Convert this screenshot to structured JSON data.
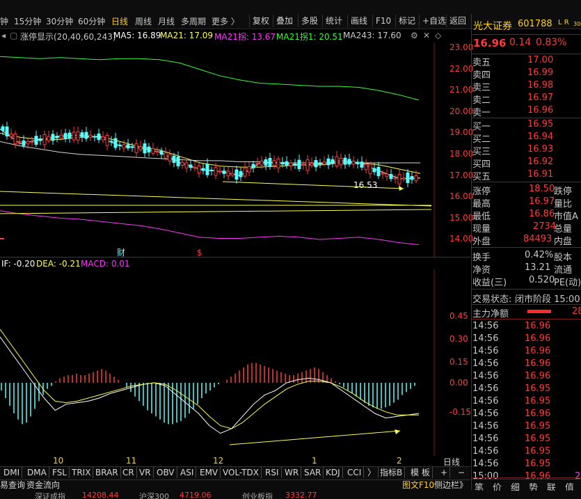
{
  "toolbar": {
    "periods": [
      "钟",
      "15分钟",
      "30分钟",
      "60分钟",
      "日线",
      "周线",
      "月线",
      "多周期",
      "更多 〉"
    ],
    "active_period": "日线",
    "tools": [
      "复权",
      "叠加",
      "多股",
      "统计",
      "画线",
      "F10",
      "标记",
      "+自选",
      "返回"
    ]
  },
  "indicator_line": {
    "label": "涨停显示(20,40,60,243)",
    "ma5": "MA5: 16.89",
    "ma21": "MA21: 17.09",
    "ma21ext": "MA21拐: 13.67",
    "ma21ext1": "MA21拐1: 20.51",
    "ma243": "MA243: 17.60"
  },
  "macd_line": {
    "dif": "IF: -0.20",
    "dea": "DEA: -0.21",
    "macd": "MACD: 0.01"
  },
  "colors": {
    "up": "#ff3a3a",
    "down": "#54ffff",
    "ma5": "#ffffff",
    "ma21": "#ffff4d",
    "ma21ext": "#ff33ff",
    "ma21ext1": "#33ff33",
    "accent": "#ffd21f"
  },
  "chart_data": [
    {
      "type": "line",
      "title": "",
      "y_ticks": [
        "23.00",
        "22.00",
        "21.00",
        "20.00",
        "19.00",
        "18.00",
        "17.00",
        "16.00",
        "15.00",
        "14.00"
      ],
      "ylim": [
        13.5,
        23.3
      ],
      "x_ticks": [
        "10",
        "11",
        "12",
        "1",
        "2"
      ],
      "annotations": [
        "16.53",
        "财",
        "$"
      ],
      "series": [
        {
          "name": "MA21拐1",
          "values": [
            22.6,
            22.55,
            22.5,
            22.55,
            22.5,
            22.45,
            22.5,
            22.5,
            22.45,
            22.3,
            22.0,
            21.7,
            21.5,
            21.35,
            21.3,
            21.25,
            21.2,
            21.2,
            21.15,
            21.0,
            20.8,
            20.55
          ]
        },
        {
          "name": "MA21拐",
          "values": [
            15.35,
            15.2,
            15.1,
            15.0,
            14.95,
            14.85,
            14.75,
            14.65,
            14.5,
            14.3,
            14.1,
            14.05,
            14.05,
            14.1,
            14.15,
            14.1,
            14.0,
            14.05,
            14.1,
            14.0,
            13.85,
            13.75
          ]
        },
        {
          "name": "MA21",
          "values": [
            19.0,
            18.8,
            18.7,
            18.7,
            18.8,
            18.85,
            18.6,
            18.35,
            18.2,
            17.9,
            17.6,
            17.45,
            17.4,
            17.4,
            17.45,
            17.5,
            17.5,
            17.6,
            17.6,
            17.5,
            17.3,
            17.1
          ]
        },
        {
          "name": "MA5",
          "values": [
            19.2,
            18.5,
            18.7,
            18.85,
            18.9,
            18.8,
            18.4,
            18.3,
            18.1,
            17.6,
            17.3,
            17.2,
            17.0,
            17.6,
            17.6,
            17.5,
            17.55,
            17.7,
            17.6,
            17.2,
            16.85,
            16.89
          ]
        },
        {
          "name": "MA243",
          "values": [
            18.6,
            18.4,
            18.25,
            18.1,
            18.0,
            17.95,
            17.9,
            17.85,
            17.8,
            17.75,
            17.7,
            17.7,
            17.65,
            17.65,
            17.6,
            17.6,
            17.6,
            17.6,
            17.6,
            17.6,
            17.6,
            17.6
          ]
        }
      ]
    },
    {
      "type": "bar",
      "title": "",
      "y_ticks": [
        "0.45",
        "0.30",
        "0.15",
        "0.00",
        "-0.15"
      ],
      "ylim": [
        -0.33,
        0.62
      ],
      "x": [
        0,
        1,
        2,
        3,
        4,
        5,
        6,
        7,
        8,
        9,
        10,
        11,
        12,
        13,
        14,
        15,
        16,
        17,
        18,
        19,
        20,
        21,
        22,
        23,
        24,
        25,
        26,
        27,
        28,
        29,
        30,
        31,
        32,
        33,
        34,
        35,
        36,
        37,
        38,
        39,
        40,
        41,
        42,
        43,
        44,
        45,
        46,
        47,
        48,
        49,
        50,
        51,
        52,
        53,
        54,
        55,
        56,
        57,
        58,
        59,
        60,
        61,
        62,
        63,
        64,
        65,
        66,
        67,
        68,
        69,
        70,
        71,
        72,
        73,
        74,
        75,
        76,
        77,
        78,
        79,
        80,
        81,
        82,
        83,
        84,
        85,
        86,
        87,
        88,
        89,
        90,
        91,
        92,
        93,
        94,
        95,
        96,
        97,
        98,
        99
      ],
      "series": [
        {
          "name": "MACD",
          "values": [
            -0.05,
            -0.1,
            -0.15,
            -0.2,
            -0.24,
            -0.27,
            -0.26,
            -0.22,
            -0.17,
            -0.12,
            -0.08,
            -0.04,
            -0.02,
            0.01,
            0.03,
            0.04,
            0.05,
            0.05,
            0.06,
            0.05,
            0.05,
            0.06,
            0.07,
            0.08,
            0.09,
            0.08,
            0.06,
            0.04,
            0.02,
            0.0,
            -0.03,
            -0.06,
            -0.09,
            -0.12,
            -0.15,
            -0.18,
            -0.2,
            -0.22,
            -0.24,
            -0.26,
            -0.27,
            -0.27,
            -0.26,
            -0.25,
            -0.23,
            -0.2,
            -0.17,
            -0.14,
            -0.1,
            -0.07,
            -0.05,
            -0.03,
            -0.01,
            0.0,
            0.02,
            0.04,
            0.06,
            0.08,
            0.1,
            0.12,
            0.13,
            0.13,
            0.12,
            0.11,
            0.1,
            0.09,
            0.08,
            0.07,
            0.06,
            0.05,
            0.05,
            0.06,
            0.07,
            0.08,
            0.09,
            0.1,
            0.09,
            0.07,
            0.05,
            0.03,
            0.01,
            -0.01,
            -0.03,
            -0.05,
            -0.07,
            -0.09,
            -0.11,
            -0.13,
            -0.15,
            -0.16,
            -0.17,
            -0.17,
            -0.16,
            -0.15,
            -0.13,
            -0.11,
            -0.08,
            -0.06,
            -0.04,
            -0.02
          ]
        },
        {
          "name": "DIF",
          "values": [
            0.3,
            0.2,
            0.1,
            0.0,
            -0.1,
            -0.18,
            -0.14,
            -0.13,
            -0.12,
            -0.1,
            -0.07,
            -0.05,
            -0.03,
            -0.01,
            0.0,
            -0.02,
            -0.08,
            -0.14,
            -0.2,
            -0.28,
            -0.33,
            -0.3,
            -0.22,
            -0.14,
            -0.08,
            -0.05,
            0.0,
            0.02,
            0.03,
            0.02,
            0.0,
            -0.05,
            -0.1,
            -0.15,
            -0.2,
            -0.23,
            -0.22,
            -0.21,
            -0.2
          ]
        },
        {
          "name": "DEA",
          "values": [
            0.35,
            0.25,
            0.15,
            0.05,
            -0.05,
            -0.12,
            -0.13,
            -0.12,
            -0.1,
            -0.08,
            -0.06,
            -0.04,
            -0.02,
            -0.01,
            0.0,
            -0.01,
            -0.05,
            -0.1,
            -0.15,
            -0.22,
            -0.28,
            -0.3,
            -0.26,
            -0.2,
            -0.14,
            -0.09,
            -0.04,
            -0.01,
            0.01,
            0.01,
            0.0,
            -0.03,
            -0.07,
            -0.12,
            -0.16,
            -0.19,
            -0.21,
            -0.21,
            -0.21
          ]
        }
      ]
    }
  ],
  "stock": {
    "name": "光大证券",
    "code": "601788",
    "flags": "L R",
    "flags_small": "300",
    "price": "16.96",
    "change": "0.14",
    "pct": "0.83%"
  },
  "orderbook": {
    "asks": [
      {
        "label": "卖五",
        "price": "17.00"
      },
      {
        "label": "卖四",
        "price": "16.99"
      },
      {
        "label": "卖三",
        "price": "16.98"
      },
      {
        "label": "卖二",
        "price": "16.97"
      },
      {
        "label": "卖一",
        "price": "16.96"
      }
    ],
    "bids": [
      {
        "label": "买一",
        "price": "16.95"
      },
      {
        "label": "买二",
        "price": "16.94"
      },
      {
        "label": "买三",
        "price": "16.93"
      },
      {
        "label": "买四",
        "price": "16.92"
      },
      {
        "label": "买五",
        "price": "16.91"
      }
    ]
  },
  "quote": [
    {
      "l1": "涨停",
      "v1": "18.50",
      "l2": "跌停"
    },
    {
      "l1": "最高",
      "v1": "16.97",
      "l2": "量比"
    },
    {
      "l1": "最低",
      "v1": "16.86",
      "l2": "市值A"
    },
    {
      "l1": "现量",
      "v1": "2734",
      "l2": "总量"
    },
    {
      "l1": "外盘",
      "v1": "84493",
      "l2": "内盘"
    }
  ],
  "stats": [
    {
      "l1": "换手",
      "v1": "0.42%",
      "l2": "股本"
    },
    {
      "l1": "净资",
      "v1": "13.21",
      "l2": "流通"
    },
    {
      "l1": "收益(三)",
      "v1": "0.520",
      "l2": "PE(动)"
    }
  ],
  "status": {
    "label": "交易状态:",
    "value": "闭市阶段 15:00"
  },
  "mainflow": {
    "label": "主力净额",
    "value": "28"
  },
  "ticks": [
    {
      "t": "14:56",
      "p": "16.96"
    },
    {
      "t": "14:56",
      "p": "16.96"
    },
    {
      "t": "14:56",
      "p": "16.96"
    },
    {
      "t": "14:56",
      "p": "16.96"
    },
    {
      "t": "14:56",
      "p": "16.96"
    },
    {
      "t": "14:56",
      "p": "16.95"
    },
    {
      "t": "14:56",
      "p": "16.95"
    },
    {
      "t": "14:56",
      "p": "16.96"
    },
    {
      "t": "14:56",
      "p": "16.95"
    },
    {
      "t": "14:56",
      "p": "16.95"
    },
    {
      "t": "14:56",
      "p": "16.95"
    },
    {
      "t": "14:56",
      "p": "16.95"
    },
    {
      "t": "15:00",
      "p": "16.96",
      "extra": "27"
    }
  ],
  "right_tabs": [
    "笔",
    "价",
    "细",
    "势",
    "联",
    "值"
  ],
  "bottom_tabs": [
    "DMI",
    "DMA",
    "FSL",
    "TRIX",
    "BRAR",
    "CR",
    "VR",
    "OBV",
    "ASI",
    "EMV",
    "VOL-TDX",
    "RSI",
    "WR",
    "SAR",
    "KDJ",
    "CCI",
    "〉",
    "指标B",
    "模 板",
    "+",
    "−",
    "日线"
  ],
  "menu_tabs": [
    "易查询",
    "资金流向",
    "图文F10",
    "侧边栏》"
  ],
  "index_bar": [
    {
      "label": "深证成指",
      "value": "14208.44"
    },
    {
      "label": "沪深300",
      "value": "4719.06"
    },
    {
      "label": "创业板指",
      "value": "3332.77"
    }
  ]
}
